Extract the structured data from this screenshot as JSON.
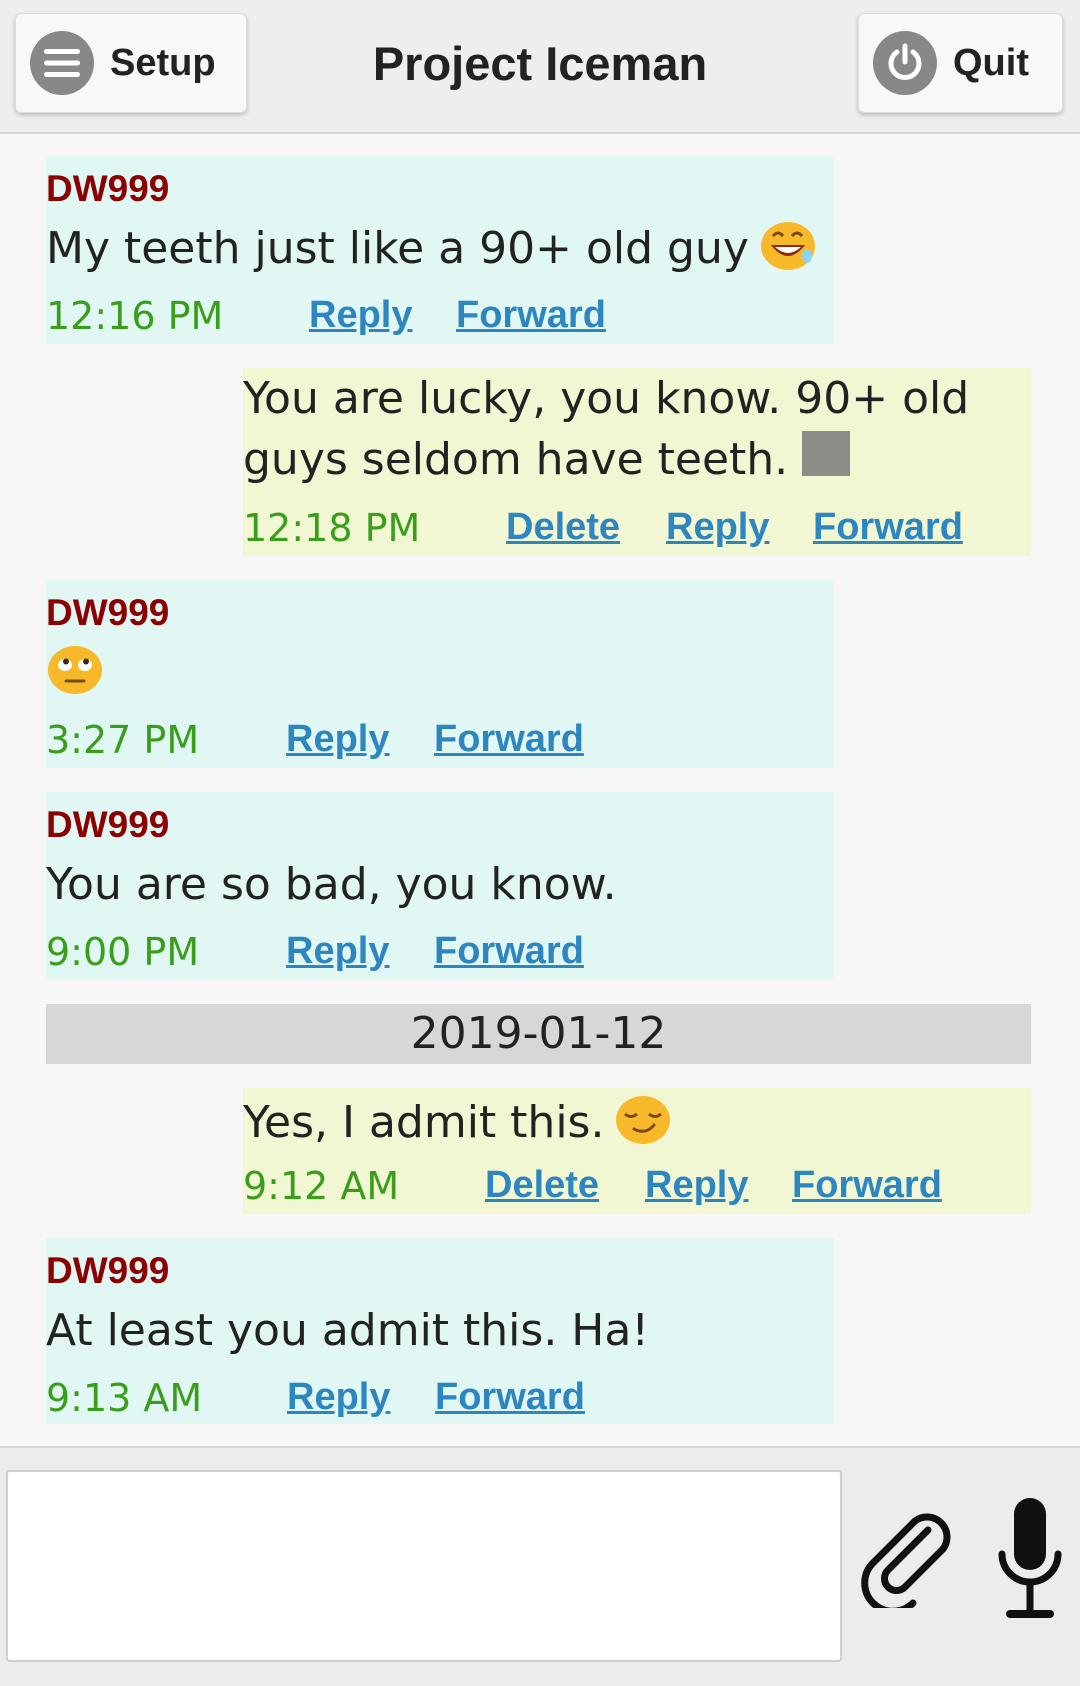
{
  "header": {
    "setup_label": "Setup",
    "title": "Project Iceman",
    "quit_label": "Quit"
  },
  "messages": [
    {
      "sender": "DW999",
      "text": "My teeth just like a 90+ old guy",
      "emoji": "grinning-sweat-emoji",
      "time": "12:16 PM",
      "reply": "Reply",
      "forward": "Forward"
    },
    {
      "text_line1": "You are lucky, you know. 90+ old",
      "text_line2": "guys seldom have teeth.",
      "emoji": "unrendered-glyph-box",
      "time": "12:18 PM",
      "delete": "Delete",
      "reply": "Reply",
      "forward": "Forward"
    },
    {
      "sender": "DW999",
      "emoji": "eye-roll-emoji",
      "time": "3:27 PM",
      "reply": "Reply",
      "forward": "Forward"
    },
    {
      "sender": "DW999",
      "text": "You are so bad, you know.",
      "time": "9:00 PM",
      "reply": "Reply",
      "forward": "Forward"
    },
    {
      "text": "Yes, I admit this.",
      "emoji": "smirk-emoji",
      "time": "9:12 AM",
      "delete": "Delete",
      "reply": "Reply",
      "forward": "Forward"
    },
    {
      "sender": "DW999",
      "text": "At least you admit this. Ha!",
      "time": "9:13 AM",
      "reply": "Reply",
      "forward": "Forward"
    }
  ],
  "date_separator": "2019-01-12",
  "footer": {
    "compose_value": "",
    "icons": [
      "paperclip-icon",
      "microphone-icon"
    ]
  },
  "colors": {
    "incoming_bg": "#e0f7f4",
    "outgoing_bg": "#f1f7d2",
    "sender": "#8b0000",
    "time": "#3a9e1a",
    "link": "#2e86c1"
  }
}
